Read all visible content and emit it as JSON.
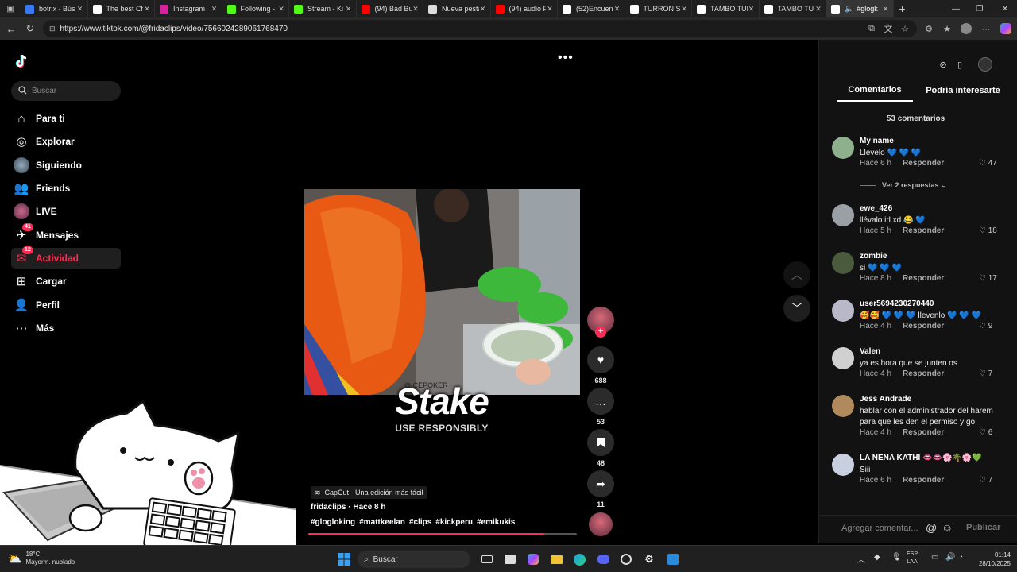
{
  "browser": {
    "tabs": [
      {
        "label": "botrix - Bús",
        "color": "#3a78f2"
      },
      {
        "label": "The best Ch",
        "color": "#ffffff"
      },
      {
        "label": "Instagram",
        "color": "#d6249f"
      },
      {
        "label": "Following -",
        "color": "#53fc18"
      },
      {
        "label": "Stream - Ki",
        "color": "#53fc18"
      },
      {
        "label": "(94) Bad Bu",
        "color": "#ff0000"
      },
      {
        "label": "Nueva pesta",
        "color": "#dddddd"
      },
      {
        "label": "(94) audio F",
        "color": "#ff0000"
      },
      {
        "label": "(52)Encuent",
        "color": "#ffffff"
      },
      {
        "label": "TURRON SI",
        "color": "#ffffff"
      },
      {
        "label": "TAMBO TUR",
        "color": "#ffffff"
      },
      {
        "label": "TAMBO TUR",
        "color": "#ffffff"
      },
      {
        "label": "#glogk",
        "color": "#ffffff"
      }
    ],
    "url": "https://www.tiktok.com/@fridaclips/video/7566024289061768470"
  },
  "sidebar": {
    "search_placeholder": "Buscar",
    "items": [
      {
        "label": "Para ti",
        "icon": "home-icon"
      },
      {
        "label": "Explorar",
        "icon": "compass-icon"
      },
      {
        "label": "Siguiendo",
        "icon": "following-avatar"
      },
      {
        "label": "Friends",
        "icon": "friends-icon"
      },
      {
        "label": "LIVE",
        "icon": "live-avatar"
      },
      {
        "label": "Mensajes",
        "icon": "messages-icon",
        "badge": "41"
      },
      {
        "label": "Actividad",
        "icon": "activity-icon",
        "badge": "12"
      },
      {
        "label": "Cargar",
        "icon": "upload-icon"
      },
      {
        "label": "Perfil",
        "icon": "profile-icon"
      },
      {
        "label": "Más",
        "icon": "more-icon"
      }
    ]
  },
  "video": {
    "sponsor_text": "Stake",
    "sponsor_subtext": "USE RESPONSIBLY",
    "sponsor_tag": "@ICEPOKER",
    "capcut_label": "CapCut · Una edición más fácil",
    "author_line": "fridaclips · Hace 8 h",
    "hashtags": [
      "#glogloking",
      "#mattkeelan",
      "#clips",
      "#kickperu",
      "#emikukis"
    ],
    "progress": 0.88
  },
  "actions": {
    "likes": "688",
    "comments": "53",
    "saves": "48",
    "shares": "11"
  },
  "panel": {
    "tab_comments": "Comentarios",
    "tab_interest": "Podría interesarte",
    "comment_count": "53 comentarios",
    "reply_label": "Responder",
    "view_replies": "Ver 2 respuestas",
    "comment_placeholder": "Agregar comentar...",
    "publish_label": "Publicar",
    "comments": [
      {
        "name": "My name",
        "text": "Llevelo 💙 💙 💙",
        "time": "Hace 6 h",
        "likes": "47",
        "avatar_color": "#8fb08c"
      },
      {
        "name": "ewe_426",
        "text": "llévalo irl xd 😂 💙",
        "time": "Hace 5 h",
        "likes": "18",
        "avatar_color": "#9aa0a6"
      },
      {
        "name": "zombie",
        "text": "si 💙 💙 💙",
        "time": "Hace 8 h",
        "likes": "17",
        "avatar_color": "#4a5a3c"
      },
      {
        "name": "user5694230270440",
        "text": "🥰🥰 💙 💙 💙 llevenlo 💙 💙 💙",
        "time": "Hace 4 h",
        "likes": "9",
        "avatar_color": "#b8b8c8"
      },
      {
        "name": "Valen",
        "text": "ya es hora que se junten os",
        "time": "Hace 4 h",
        "likes": "7",
        "avatar_color": "#d0d0d0"
      },
      {
        "name": "Jess Andrade",
        "text": "hablar con el administrador del harem para que les den el permiso y go",
        "time": "Hace 4 h",
        "likes": "6",
        "avatar_color": "#b08a5c"
      },
      {
        "name": "LA NENA KATHI 👄👄🌸🌴🌸💚",
        "text": "Siii",
        "time": "Hace 6 h",
        "likes": "7",
        "avatar_color": "#c8d0e0"
      }
    ]
  },
  "taskbar": {
    "temperature": "18°C",
    "weather": "Mayorm. nublado",
    "search": "Buscar",
    "lang_top": "ESP",
    "lang_bottom": "LAA",
    "time": "01:14",
    "date": "28/10/2025"
  }
}
